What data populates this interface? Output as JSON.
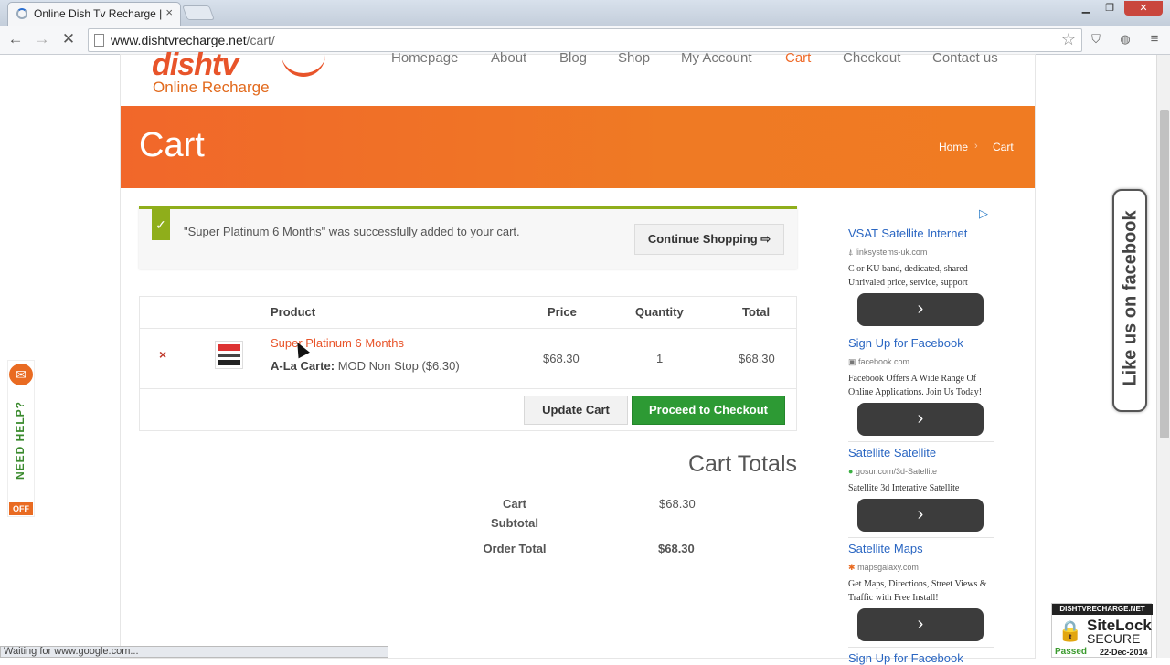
{
  "browser": {
    "tab_title": "Online Dish Tv Recharge |",
    "tab_close": "×",
    "url_host": "www.dishtvrecharge.net",
    "url_path": "/cart/",
    "status_text": "Waiting for www.google.com..."
  },
  "site": {
    "logo_text": "dishtv",
    "logo_subtitle": "Online Recharge",
    "nav": [
      "Homepage",
      "About",
      "Blog",
      "Shop",
      "My Account",
      "Cart",
      "Checkout",
      "Contact us"
    ],
    "active_nav": "Cart",
    "accent_color": "#ef6b2a"
  },
  "banner": {
    "title": "Cart",
    "breadcrumb_home": "Home",
    "breadcrumb_sep": "›",
    "breadcrumb_current": "Cart"
  },
  "notice": {
    "check": "✓",
    "message": "\"Super Platinum 6 Months\" was successfully added to your cart.",
    "continue_label": "Continue Shopping ⇨"
  },
  "cart": {
    "headers": {
      "product": "Product",
      "price": "Price",
      "quantity": "Quantity",
      "total": "Total"
    },
    "remove_label": "×",
    "item": {
      "name": "Super Platinum 6 Months",
      "meta_label": "A-La Carte:",
      "meta_value": "MOD Non Stop ($6.30)",
      "price": "$68.30",
      "quantity": "1",
      "total": "$68.30"
    },
    "update_label": "Update Cart",
    "checkout_label": "Proceed to Checkout"
  },
  "totals": {
    "title": "Cart Totals",
    "subtotal_label_1": "Cart",
    "subtotal_label_2": "Subtotal",
    "subtotal_value": "$68.30",
    "order_total_label": "Order Total",
    "order_total_value": "$68.30"
  },
  "ads": [
    {
      "title": "VSAT Satellite Internet",
      "url": "linksystems-uk.com",
      "desc": "C or KU band, dedicated, shared Unrivaled price, service, support",
      "go": "›"
    },
    {
      "title": "Sign Up for Facebook",
      "url": "facebook.com",
      "desc": "Facebook Offers A Wide Range Of Online Applications. Join Us Today!",
      "go": "›"
    },
    {
      "title": "Satellite Satellite",
      "url": "gosur.com/3d-Satellite",
      "desc": "Satellite 3d Interative Satellite",
      "go": "›"
    },
    {
      "title": "Satellite Maps",
      "url": "mapsgalaxy.com",
      "desc": "Get Maps, Directions, Street Views & Traffic with Free Install!",
      "go": "›"
    },
    {
      "title": "Sign Up for Facebook"
    }
  ],
  "widgets": {
    "facebook_tab": "Like us on facebook",
    "need_help": "NEED HELP?",
    "need_help_off": "OFF",
    "sitelock_top": "DISHTVRECHARGE.NET",
    "sitelock_name": "SiteLock",
    "sitelock_secure": "SECURE",
    "sitelock_passed": "Passed",
    "sitelock_date": "22-Dec-2014"
  }
}
